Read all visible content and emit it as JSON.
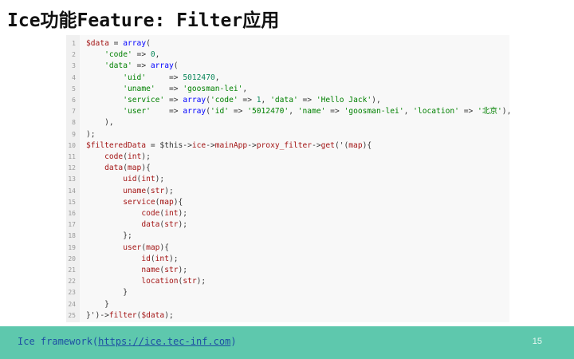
{
  "slide": {
    "title": "Ice功能Feature: Filter应用",
    "page_number": "15"
  },
  "footer": {
    "prefix": "Ice framework(",
    "link": "https://ice.tec-inf.com",
    "suffix": ")"
  },
  "code": {
    "lines": [
      [
        {
          "t": "$data",
          "c": "var"
        },
        {
          "t": " = "
        },
        {
          "t": "array",
          "c": "kw"
        },
        {
          "t": "("
        }
      ],
      [
        {
          "t": "    "
        },
        {
          "t": "'code'",
          "c": "str"
        },
        {
          "t": " => "
        },
        {
          "t": "0",
          "c": "num"
        },
        {
          "t": ","
        }
      ],
      [
        {
          "t": "    "
        },
        {
          "t": "'data'",
          "c": "str"
        },
        {
          "t": " => "
        },
        {
          "t": "array",
          "c": "kw"
        },
        {
          "t": "("
        }
      ],
      [
        {
          "t": "        "
        },
        {
          "t": "'uid'",
          "c": "str"
        },
        {
          "t": "     => "
        },
        {
          "t": "5012470",
          "c": "num"
        },
        {
          "t": ","
        }
      ],
      [
        {
          "t": "        "
        },
        {
          "t": "'uname'",
          "c": "str"
        },
        {
          "t": "   => "
        },
        {
          "t": "'goosman-lei'",
          "c": "str"
        },
        {
          "t": ","
        }
      ],
      [
        {
          "t": "        "
        },
        {
          "t": "'service'",
          "c": "str"
        },
        {
          "t": " => "
        },
        {
          "t": "array",
          "c": "kw"
        },
        {
          "t": "("
        },
        {
          "t": "'code'",
          "c": "str"
        },
        {
          "t": " => "
        },
        {
          "t": "1",
          "c": "num"
        },
        {
          "t": ", "
        },
        {
          "t": "'data'",
          "c": "str"
        },
        {
          "t": " => "
        },
        {
          "t": "'Hello Jack'",
          "c": "str"
        },
        {
          "t": "),"
        }
      ],
      [
        {
          "t": "        "
        },
        {
          "t": "'user'",
          "c": "str"
        },
        {
          "t": "    => "
        },
        {
          "t": "array",
          "c": "kw"
        },
        {
          "t": "("
        },
        {
          "t": "'id'",
          "c": "str"
        },
        {
          "t": " => "
        },
        {
          "t": "'5012470'",
          "c": "str"
        },
        {
          "t": ", "
        },
        {
          "t": "'name'",
          "c": "str"
        },
        {
          "t": " => "
        },
        {
          "t": "'goosman-lei'",
          "c": "str"
        },
        {
          "t": ", "
        },
        {
          "t": "'location'",
          "c": "str"
        },
        {
          "t": " => "
        },
        {
          "t": "'北京'",
          "c": "str"
        },
        {
          "t": "),"
        }
      ],
      [
        {
          "t": "    ),"
        }
      ],
      [
        {
          "t": ");"
        }
      ],
      [
        {
          "t": "$filteredData",
          "c": "var"
        },
        {
          "t": " = $this->"
        },
        {
          "t": "ice",
          "c": "fn"
        },
        {
          "t": "->"
        },
        {
          "t": "mainApp",
          "c": "fn"
        },
        {
          "t": "->"
        },
        {
          "t": "proxy_filter",
          "c": "fn"
        },
        {
          "t": "->"
        },
        {
          "t": "get",
          "c": "fn"
        },
        {
          "t": "('("
        },
        {
          "t": "map",
          "c": "fn"
        },
        {
          "t": "){"
        }
      ],
      [
        {
          "t": "    "
        },
        {
          "t": "code",
          "c": "fn"
        },
        {
          "t": "("
        },
        {
          "t": "int",
          "c": "fn"
        },
        {
          "t": ");"
        }
      ],
      [
        {
          "t": "    "
        },
        {
          "t": "data",
          "c": "fn"
        },
        {
          "t": "("
        },
        {
          "t": "map",
          "c": "fn"
        },
        {
          "t": "){"
        }
      ],
      [
        {
          "t": "        "
        },
        {
          "t": "uid",
          "c": "fn"
        },
        {
          "t": "("
        },
        {
          "t": "int",
          "c": "fn"
        },
        {
          "t": ");"
        }
      ],
      [
        {
          "t": "        "
        },
        {
          "t": "uname",
          "c": "fn"
        },
        {
          "t": "("
        },
        {
          "t": "str",
          "c": "fn"
        },
        {
          "t": ");"
        }
      ],
      [
        {
          "t": "        "
        },
        {
          "t": "service",
          "c": "fn"
        },
        {
          "t": "("
        },
        {
          "t": "map",
          "c": "fn"
        },
        {
          "t": "){"
        }
      ],
      [
        {
          "t": "            "
        },
        {
          "t": "code",
          "c": "fn"
        },
        {
          "t": "("
        },
        {
          "t": "int",
          "c": "fn"
        },
        {
          "t": ");"
        }
      ],
      [
        {
          "t": "            "
        },
        {
          "t": "data",
          "c": "fn"
        },
        {
          "t": "("
        },
        {
          "t": "str",
          "c": "fn"
        },
        {
          "t": ");"
        }
      ],
      [
        {
          "t": "        };"
        }
      ],
      [
        {
          "t": "        "
        },
        {
          "t": "user",
          "c": "fn"
        },
        {
          "t": "("
        },
        {
          "t": "map",
          "c": "fn"
        },
        {
          "t": "){"
        }
      ],
      [
        {
          "t": "            "
        },
        {
          "t": "id",
          "c": "fn"
        },
        {
          "t": "("
        },
        {
          "t": "int",
          "c": "fn"
        },
        {
          "t": ");"
        }
      ],
      [
        {
          "t": "            "
        },
        {
          "t": "name",
          "c": "fn"
        },
        {
          "t": "("
        },
        {
          "t": "str",
          "c": "fn"
        },
        {
          "t": ");"
        }
      ],
      [
        {
          "t": "            "
        },
        {
          "t": "location",
          "c": "fn"
        },
        {
          "t": "("
        },
        {
          "t": "str",
          "c": "fn"
        },
        {
          "t": ");"
        }
      ],
      [
        {
          "t": "        }"
        }
      ],
      [
        {
          "t": "    }"
        }
      ],
      [
        {
          "t": "}')->"
        },
        {
          "t": "filter",
          "c": "fn"
        },
        {
          "t": "("
        },
        {
          "t": "$data",
          "c": "var"
        },
        {
          "t": ");"
        }
      ]
    ]
  }
}
